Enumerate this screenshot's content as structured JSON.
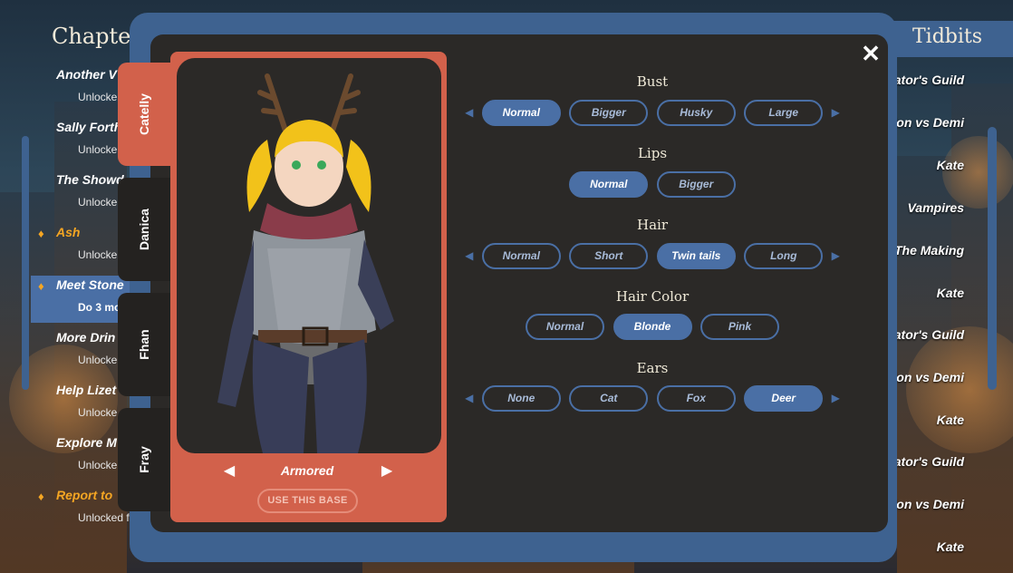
{
  "chapters": {
    "title": "Chapter",
    "items": [
      {
        "title": "Another V",
        "subtitle": "Unlocke",
        "marker": false,
        "selected": false,
        "highlight": false
      },
      {
        "title": "Sally Forth",
        "subtitle": "Unlocke",
        "marker": false,
        "selected": false,
        "highlight": false
      },
      {
        "title": "The Showd",
        "subtitle": "Unlocke",
        "marker": false,
        "selected": false,
        "highlight": false
      },
      {
        "title": "Ash",
        "subtitle": "Unlocke",
        "marker": true,
        "selected": false,
        "highlight": true
      },
      {
        "title": "Meet Stone",
        "subtitle": "Do 3 mo",
        "marker": true,
        "selected": true,
        "highlight": false
      },
      {
        "title": "More Drin",
        "subtitle": "Unlocke",
        "marker": false,
        "selected": false,
        "highlight": false
      },
      {
        "title": "Help Lizet",
        "subtitle": "Unlocke",
        "marker": false,
        "selected": false,
        "highlight": false
      },
      {
        "title": "Explore M",
        "subtitle": "Unlocke",
        "marker": false,
        "selected": false,
        "highlight": false
      },
      {
        "title": "Report to",
        "subtitle": "Unlocked f",
        "marker": true,
        "selected": false,
        "highlight": true
      }
    ]
  },
  "tidbits": {
    "title": "Tidbits",
    "items": [
      "ator's Guild",
      "lon vs Demi",
      "Kate",
      "Vampires",
      "The Making",
      "Kate",
      "ator's Guild",
      "lon vs Demi",
      "Kate",
      "ator's Guild",
      "lon vs Demi",
      "Kate"
    ]
  },
  "modal": {
    "close_symbol": "✕",
    "character_tabs": [
      "Catelly",
      "Danica",
      "Fhan",
      "Fray"
    ],
    "active_tab": "Catelly",
    "outfit": {
      "name": "Armored",
      "prev_symbol": "◀",
      "next_symbol": "▶"
    },
    "use_base_label": "USE THIS BASE",
    "options": {
      "bust": {
        "title": "Bust",
        "choices": [
          "Normal",
          "Bigger",
          "Husky",
          "Large"
        ],
        "selected": "Normal",
        "has_arrows": true
      },
      "lips": {
        "title": "Lips",
        "choices": [
          "Normal",
          "Bigger"
        ],
        "selected": "Normal",
        "has_arrows": false
      },
      "hair": {
        "title": "Hair",
        "choices": [
          "Normal",
          "Short",
          "Twin tails",
          "Long"
        ],
        "selected": "Twin tails",
        "has_arrows": true
      },
      "hair_color": {
        "title": "Hair Color",
        "choices": [
          "Normal",
          "Blonde",
          "Pink"
        ],
        "selected": "Blonde",
        "has_arrows": false
      },
      "ears": {
        "title": "Ears",
        "choices": [
          "None",
          "Cat",
          "Fox",
          "Deer"
        ],
        "selected": "Deer",
        "has_arrows": true
      }
    },
    "arrow_left": "◀",
    "arrow_right": "▶"
  },
  "colors": {
    "accent_blue": "#4a6fa5",
    "accent_red": "#d2614b",
    "panel_dark": "#2b2927",
    "highlight_orange": "#f5a623"
  }
}
